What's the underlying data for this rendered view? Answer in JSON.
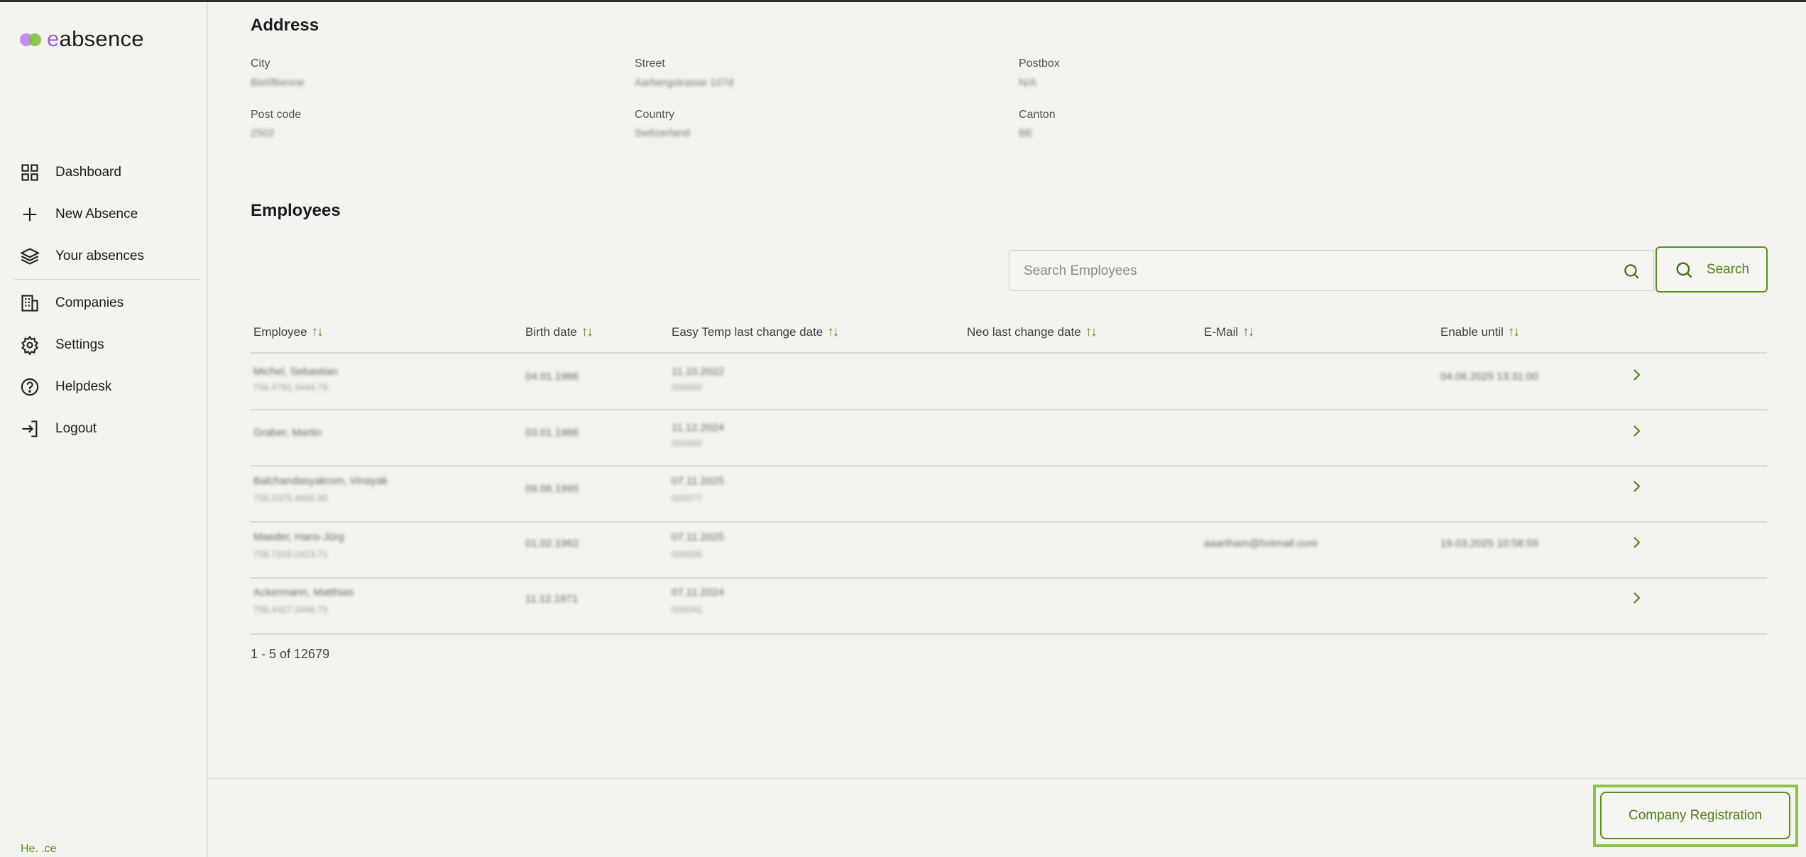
{
  "app": {
    "logo_prefix": "e",
    "logo_rest": "absence"
  },
  "nav": {
    "dashboard": "Dashboard",
    "new_absence": "New Absence",
    "your_absences": "Your absences",
    "companies": "Companies",
    "settings": "Settings",
    "helpdesk": "Helpdesk",
    "logout": "Logout"
  },
  "sidebar_footer": "He.             .ce",
  "address": {
    "title": "Address",
    "city_label": "City",
    "city_value": "Biel/Bienne",
    "street_label": "Street",
    "street_value": "Aarbergstrasse 107d",
    "postbox_label": "Postbox",
    "postbox_value": "N/A",
    "postcode_label": "Post code",
    "postcode_value": "2502",
    "country_label": "Country",
    "country_value": "Switzerland",
    "canton_label": "Canton",
    "canton_value": "BE"
  },
  "employees": {
    "title": "Employees",
    "search_placeholder": "Search Employees",
    "search_button": "Search",
    "columns": [
      "Employee",
      "Birth date",
      "Easy Temp last change date",
      "Neo last change date",
      "E-Mail",
      "Enable until"
    ],
    "sort_glyph": "↑↓",
    "rows": [
      {
        "name": "Michel, Sebastian",
        "ssn": "756.4791.3444.79",
        "birth": "04.01.1986",
        "easytemp": "11.10.2022",
        "easytemp_sub": "000000",
        "neo": "",
        "email": "",
        "enable_until": "04.06.2025 13:31:00"
      },
      {
        "name": "Graber, Martin",
        "ssn": "",
        "birth": "03.01.1986",
        "easytemp": "11.12.2024",
        "easytemp_sub": "000000",
        "neo": "",
        "email": "",
        "enable_until": ""
      },
      {
        "name": "Balchandasyakrom, Vinayak",
        "ssn": "756.0375.4666.95",
        "birth": "09.06.1995",
        "easytemp": "07.11.2025",
        "easytemp_sub": "000077",
        "neo": "",
        "email": "",
        "enable_until": ""
      },
      {
        "name": "Maeder, Hans-Jürg",
        "ssn": "756.7200.0423.71",
        "birth": "01.02.1962",
        "easytemp": "07.11.2025",
        "easytemp_sub": "000000",
        "neo": "",
        "email": "",
        "enable_until": ""
      },
      {
        "name": "Ackermann, Matthias",
        "ssn": "756.4427.3446.75",
        "birth": "11.12.1971",
        "easytemp": "07.11.2024",
        "easytemp_sub": "000041",
        "neo": "",
        "email": "",
        "enable_until": ""
      }
    ],
    "row4_email": "aaartham@hotmail.com",
    "row4_enable_until": "19.03.2025 10:58:59",
    "pager": "1 - 5 of 12679"
  },
  "footer": {
    "register_button": "Company Registration"
  },
  "colors": {
    "accent": "#5a8f1a",
    "highlight": "#8bc34a",
    "background": "#f3f3ef"
  }
}
